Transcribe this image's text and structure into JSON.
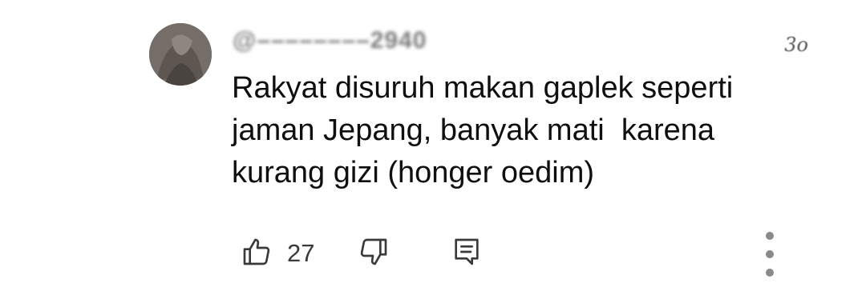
{
  "comment": {
    "author_handle": "@––––––––2940",
    "timestamp": "3o",
    "text": "Rakyat disuruh makan gaplek seperti\njaman Jepang, banyak mati  karena\nkurang gizi (honger oedim)",
    "like_count": "27"
  },
  "icons": {
    "like": "thumbs-up-icon",
    "dislike": "thumbs-down-icon",
    "reply": "comment-icon",
    "more": "more-vertical-icon"
  },
  "colors": {
    "text": "#0f0f0f",
    "secondary_text": "#3a3a3a",
    "icon": "#3a3a3a",
    "background": "#ffffff"
  }
}
